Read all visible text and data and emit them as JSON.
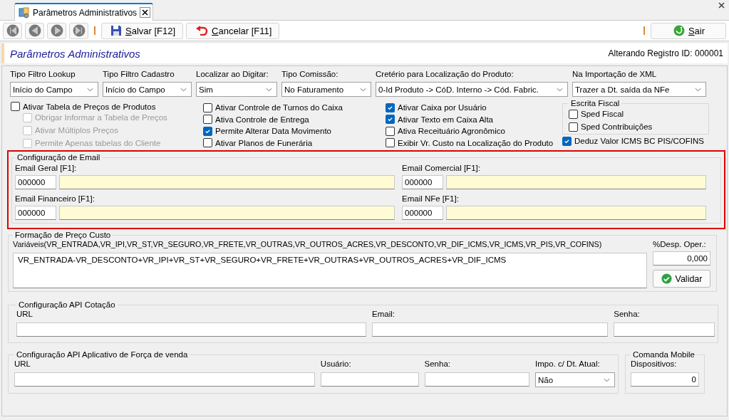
{
  "tab": {
    "title": "Parâmetros Administrativos"
  },
  "toolbar": {
    "nav_buttons": [
      {
        "kind": "first"
      },
      {
        "kind": "previous"
      },
      {
        "kind": "next"
      },
      {
        "kind": "last"
      }
    ],
    "actions": [
      {
        "kind": "save",
        "label": "Salvar [F12]"
      },
      {
        "kind": "cancel",
        "label": "Cancelar [F11]"
      }
    ],
    "exit": {
      "label": "Sair"
    }
  },
  "header": {
    "title": "Parâmetros Administrativos",
    "status": "Alterando Registro ID: 000001"
  },
  "dropdowns": [
    {
      "label": "Tipo Filtro Lookup",
      "value": "Início do Campo"
    },
    {
      "label": "Tipo Filtro Cadastro",
      "value": "Início do Campo"
    },
    {
      "label": "Localizar ao Digitar:",
      "value": "Sim"
    },
    {
      "label": "Tipo Comissão:",
      "value": "No Faturamento"
    },
    {
      "label": "Cretério para Localização do Produto:",
      "value": "0-Id Produto -> CóD. Interno -> Cód. Fabric."
    },
    {
      "label": "Na Importação de XML",
      "value": "Trazer a Dt. saída da NFe"
    }
  ],
  "checkbox_columns": [
    [
      {
        "label": "Ativar Tabela de Preços de Produtos",
        "checked": false,
        "disabled": false,
        "children": [
          {
            "label": "Obrigar Informar a Tabela de Preços",
            "checked": false,
            "disabled": true
          },
          {
            "label": "Ativar Múltiplos Preços",
            "checked": false,
            "disabled": true
          },
          {
            "label": "Permite Apenas tabelas do Cliente",
            "checked": false,
            "disabled": true
          }
        ]
      }
    ],
    [
      {
        "label": "Ativar Controle de Turnos do Caixa",
        "checked": false,
        "disabled": false
      },
      {
        "label": "Ativa Controle de Entrega",
        "checked": false,
        "disabled": false
      },
      {
        "label": "Permite Alterar Data Movimento",
        "checked": true,
        "disabled": false
      },
      {
        "label": "Ativar Planos de Funerária",
        "checked": false,
        "disabled": false
      }
    ],
    [
      {
        "label": "Ativar Caixa por Usuário",
        "checked": true,
        "disabled": false
      },
      {
        "label": "Ativar Texto em Caixa Alta",
        "checked": true,
        "disabled": false
      },
      {
        "label": "Ativa Receituário Agronômico",
        "checked": false,
        "disabled": false
      },
      {
        "label": "Exibir Vr. Custo na Localização do Produto",
        "checked": false,
        "disabled": false
      }
    ]
  ],
  "fiscal": {
    "title": "Escrita Fiscal",
    "checkboxes": [
      {
        "label": "Sped Fiscal",
        "checked": false,
        "disabled": false
      },
      {
        "label": "Sped Contribuições",
        "checked": false,
        "disabled": false
      }
    ]
  },
  "icms_deduction": {
    "label": "Deduz Valor ICMS BC PIS/COFINS",
    "checked": true,
    "disabled": false
  },
  "email_config": {
    "title": "Configuração de Email",
    "highlighted": true,
    "fields": [
      {
        "label": "Email Geral [F1]:",
        "code": "000000"
      },
      {
        "label": "Email Comercial [F1]:",
        "code": "000000"
      },
      {
        "label": "Email Financeiro [F1]:",
        "code": "000000"
      },
      {
        "label": "Email NFe [F1]:",
        "code": "000000"
      }
    ]
  },
  "price_formation": {
    "title": "Formação de Preço Custo",
    "variables": "Variáveis(VR_ENTRADA,VR_IPI,VR_ST,VR_SEGURO,VR_FRETE,VR_OUTRAS,VR_OUTROS_ACRES,VR_DESCONTO,VR_DIF_ICMS,VR_ICMS,VR_PIS,VR_COFINS)",
    "formula": "VR_ENTRADA-VR_DESCONTO+VR_IPI+VR_ST+VR_SEGURO+VR_FRETE+VR_OUTRAS+VR_OUTROS_ACRES+VR_DIF_ICMS",
    "expense_label": "%Desp. Oper.:",
    "expense_value": "0,000",
    "validate_label": "Validar"
  },
  "api_quote": {
    "title": "Configuração API Cotação",
    "fields": [
      {
        "label": "URL"
      },
      {
        "label": "Email:"
      },
      {
        "label": "Senha:"
      }
    ]
  },
  "sales_app": {
    "title": "Configuração API Aplicativo de Força de venda",
    "fields": [
      {
        "label": "URL"
      },
      {
        "label": "Usuário:"
      },
      {
        "label": "Senha:"
      }
    ],
    "import_date": {
      "label": "Impo. c/ Dt. Atual:",
      "value": "Não"
    }
  },
  "mobile": {
    "title": "Comanda Mobile",
    "label": "Dispositivos:",
    "value": "0"
  }
}
